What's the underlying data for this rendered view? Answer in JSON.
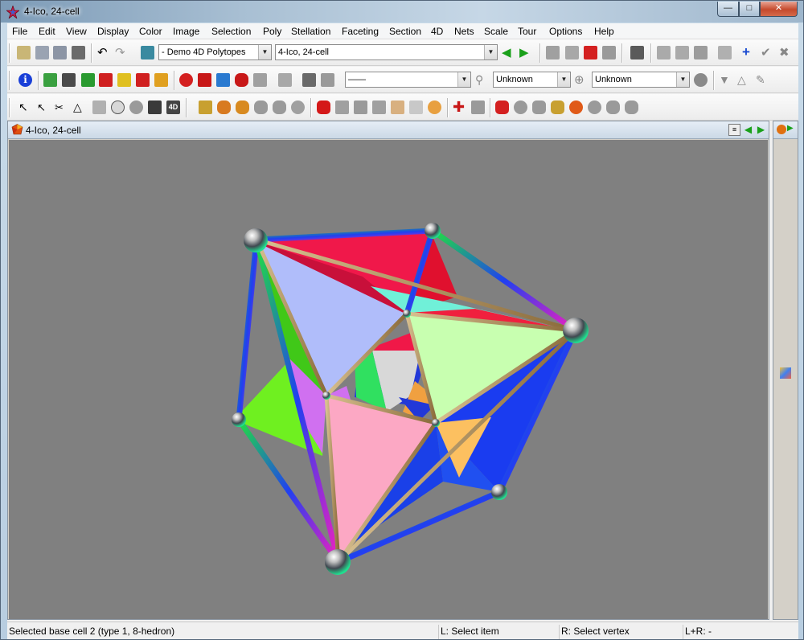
{
  "window": {
    "title": "4-Ico, 24-cell"
  },
  "menu": [
    "File",
    "Edit",
    "View",
    "Display",
    "Color",
    "Image",
    "Selection",
    "Poly",
    "Stellation",
    "Faceting",
    "Section",
    "4D",
    "Nets",
    "Scale",
    "Tour",
    "Options",
    "Help"
  ],
  "toolbar1": {
    "collection_combo": "- Demo 4D Polytopes",
    "polytope_combo": "4-Ico, 24-cell"
  },
  "toolbar2": {
    "line_combo": "——",
    "symmetry_combo_1": "Unknown",
    "symmetry_combo_2": "Unknown"
  },
  "document": {
    "title": "4-Ico, 24-cell"
  },
  "status": {
    "message": "Selected base cell 2 (type 1, 8-hedron)",
    "left_click": "L: Select item",
    "right_click": "R: Select vertex",
    "both_click": "L+R: -"
  },
  "colors": {
    "viewport_bg": "#808080",
    "face_lavender": "#b0bdfa",
    "face_lightgreen": "#c8ffb0",
    "face_pink": "#fca8c4",
    "face_green": "#6ff020",
    "face_red": "#f0184a",
    "face_blue": "#1a3cf0",
    "face_cyan": "#70f0d8",
    "face_magenta": "#d070f0",
    "face_orange": "#fcc060"
  }
}
